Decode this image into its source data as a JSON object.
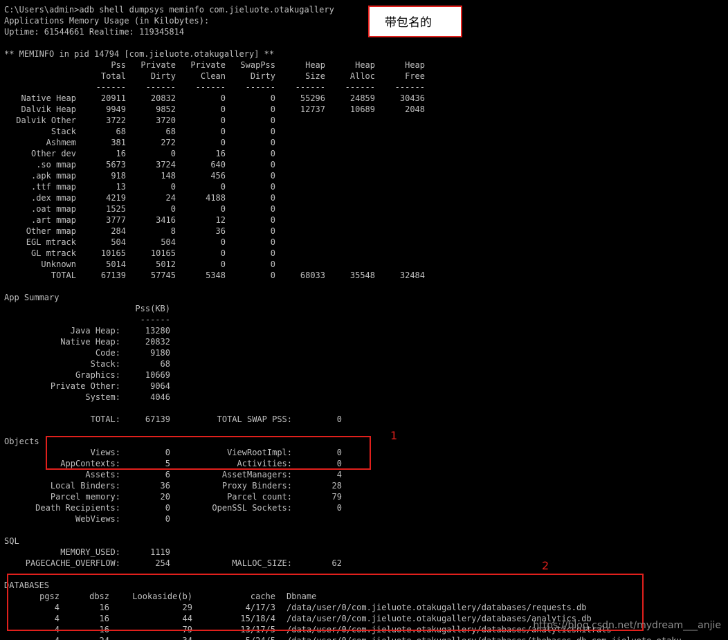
{
  "terminal": {
    "prompt": "C:\\Users\\admin>adb shell dumpsys meminfo com.jieluote.otakugallery",
    "header": "Applications Memory Usage (in Kilobytes):",
    "uptime": "Uptime: 61544661 Realtime: 119345814",
    "meminfo_title": "** MEMINFO in pid 14794 [com.jieluote.otakugallery] **",
    "meminfo_header1": [
      "",
      "Pss",
      "Private",
      "Private",
      "SwapPss",
      "Heap",
      "Heap",
      "Heap"
    ],
    "meminfo_header2": [
      "",
      "Total",
      "Dirty",
      "Clean",
      "Dirty",
      "Size",
      "Alloc",
      "Free"
    ],
    "meminfo_separator": [
      "",
      "------",
      "------",
      "------",
      "------",
      "------",
      "------",
      "------"
    ],
    "meminfo_rows": [
      [
        "Native Heap",
        "20911",
        "20832",
        "0",
        "0",
        "55296",
        "24859",
        "30436"
      ],
      [
        "Dalvik Heap",
        "9949",
        "9852",
        "0",
        "0",
        "12737",
        "10689",
        "2048"
      ],
      [
        "Dalvik Other",
        "3722",
        "3720",
        "0",
        "0",
        "",
        "",
        ""
      ],
      [
        "Stack",
        "68",
        "68",
        "0",
        "0",
        "",
        "",
        ""
      ],
      [
        "Ashmem",
        "381",
        "272",
        "0",
        "0",
        "",
        "",
        ""
      ],
      [
        "Other dev",
        "16",
        "0",
        "16",
        "0",
        "",
        "",
        ""
      ],
      [
        ".so mmap",
        "5673",
        "3724",
        "640",
        "0",
        "",
        "",
        ""
      ],
      [
        ".apk mmap",
        "918",
        "148",
        "456",
        "0",
        "",
        "",
        ""
      ],
      [
        ".ttf mmap",
        "13",
        "0",
        "0",
        "0",
        "",
        "",
        ""
      ],
      [
        ".dex mmap",
        "4219",
        "24",
        "4188",
        "0",
        "",
        "",
        ""
      ],
      [
        ".oat mmap",
        "1525",
        "0",
        "0",
        "0",
        "",
        "",
        ""
      ],
      [
        ".art mmap",
        "3777",
        "3416",
        "12",
        "0",
        "",
        "",
        ""
      ],
      [
        "Other mmap",
        "284",
        "8",
        "36",
        "0",
        "",
        "",
        ""
      ],
      [
        "EGL mtrack",
        "504",
        "504",
        "0",
        "0",
        "",
        "",
        ""
      ],
      [
        "GL mtrack",
        "10165",
        "10165",
        "0",
        "0",
        "",
        "",
        ""
      ],
      [
        "Unknown",
        "5014",
        "5012",
        "0",
        "0",
        "",
        "",
        ""
      ],
      [
        "TOTAL",
        "67139",
        "57745",
        "5348",
        "0",
        "68033",
        "35548",
        "32484"
      ]
    ],
    "app_summary_title": "App Summary",
    "app_summary_header": "Pss(KB)",
    "app_summary_separator": "------",
    "app_summary_rows": [
      [
        "Java Heap:",
        "13280"
      ],
      [
        "Native Heap:",
        "20832"
      ],
      [
        "Code:",
        "9180"
      ],
      [
        "Stack:",
        "68"
      ],
      [
        "Graphics:",
        "10669"
      ],
      [
        "Private Other:",
        "9064"
      ],
      [
        "System:",
        "4046"
      ]
    ],
    "app_summary_total": [
      "TOTAL:",
      "67139",
      "TOTAL SWAP PSS:",
      "0"
    ],
    "objects_title": "Objects",
    "objects_rows": [
      [
        "Views:",
        "0",
        "ViewRootImpl:",
        "0"
      ],
      [
        "AppContexts:",
        "5",
        "Activities:",
        "0"
      ],
      [
        "Assets:",
        "6",
        "AssetManagers:",
        "4"
      ],
      [
        "Local Binders:",
        "36",
        "Proxy Binders:",
        "28"
      ],
      [
        "Parcel memory:",
        "20",
        "Parcel count:",
        "79"
      ],
      [
        "Death Recipients:",
        "0",
        "OpenSSL Sockets:",
        "0"
      ],
      [
        "WebViews:",
        "0",
        "",
        ""
      ]
    ],
    "sql_title": "SQL",
    "sql_rows": [
      [
        "MEMORY_USED:",
        "1119",
        "",
        ""
      ],
      [
        "PAGECACHE_OVERFLOW:",
        "254",
        "MALLOC_SIZE:",
        "62"
      ]
    ],
    "databases_title": "DATABASES",
    "databases_header": [
      "pgsz",
      "dbsz",
      "Lookaside(b)",
      "cache",
      "Dbname"
    ],
    "databases_rows": [
      [
        "4",
        "16",
        "29",
        "4/17/3",
        "/data/user/0/com.jieluote.otakugallery/databases/requests.db"
      ],
      [
        "4",
        "16",
        "44",
        "15/18/4",
        "/data/user/0/com.jieluote.otakugallery/databases/analytics.db"
      ],
      [
        "4",
        "16",
        "79",
        "13/17/5",
        "/data/user/0/com.jieluote.otakugallery/databases/analyticsnitrals"
      ],
      [
        "4",
        "24",
        "34",
        "5/24/5",
        "/data/user/0/com.jieluote.otakugallery/databases/thebases.db-com.jieluote.otaku"
      ]
    ]
  },
  "annotations": {
    "callout_text": "带包名的",
    "marker_1": "1",
    "marker_2": "2",
    "watermark": "https://blog.csdn.net/mydream___anjie"
  },
  "colors": {
    "background": "#000000",
    "text": "#c0c0c0",
    "annotation": "#e0201c"
  }
}
